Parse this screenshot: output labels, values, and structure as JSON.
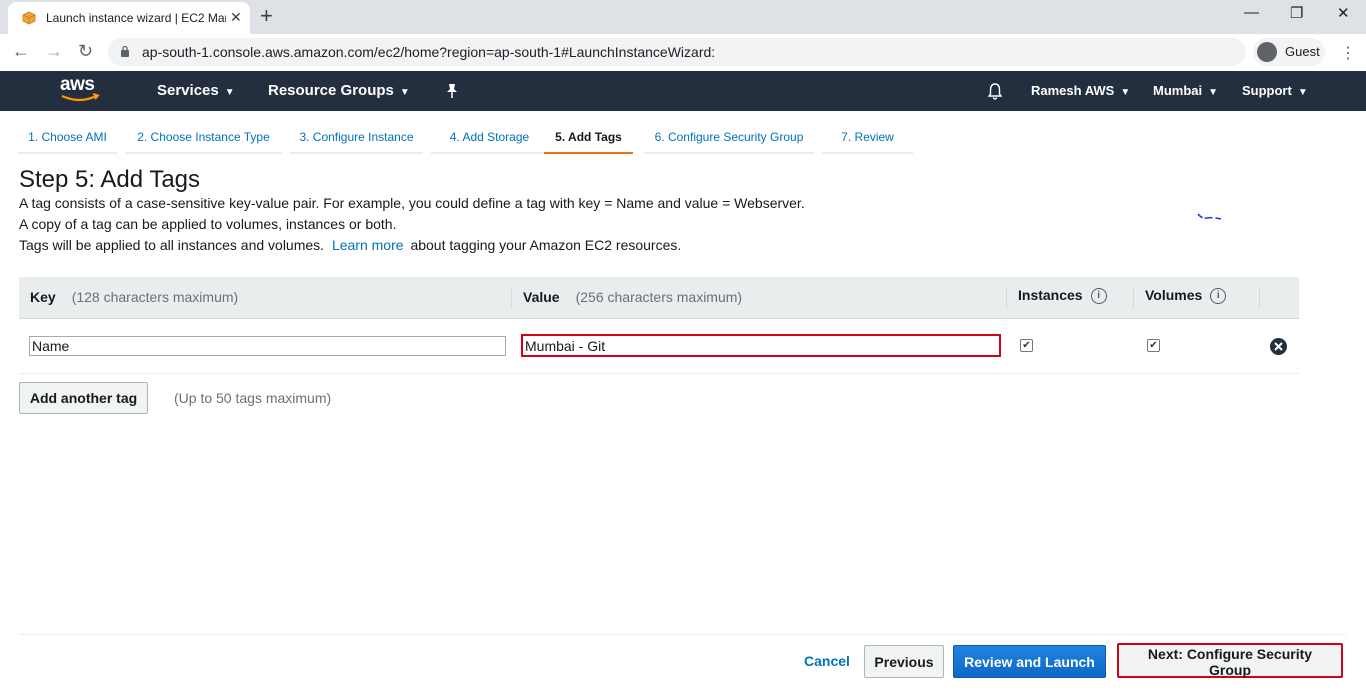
{
  "browser": {
    "tab_title": "Launch instance wizard | EC2 Management Console",
    "url": "ap-south-1.console.aws.amazon.com/ec2/home?region=ap-south-1#LaunchInstanceWizard:",
    "profile_label": "Guest",
    "icons": [
      "favicon-icon",
      "close-icon",
      "plus-icon",
      "minimize-icon",
      "restore-icon",
      "back-icon",
      "forward-icon",
      "reload-icon",
      "lock-icon",
      "avatar-icon",
      "kebab-icon"
    ]
  },
  "aws_nav": {
    "logo_text": "aws",
    "services": "Services",
    "resource_groups": "Resource Groups",
    "user": "Ramesh AWS",
    "region": "Mumbai",
    "support": "Support"
  },
  "steps": [
    {
      "label": "1. Choose AMI"
    },
    {
      "label": "2. Choose Instance Type"
    },
    {
      "label": "3. Configure Instance"
    },
    {
      "label": "4. Add Storage"
    },
    {
      "label": "5. Add Tags"
    },
    {
      "label": "6. Configure Security Group"
    },
    {
      "label": "7. Review"
    }
  ],
  "active_step": 4,
  "page": {
    "title": "Step 5: Add Tags",
    "desc1": "A tag consists of a case-sensitive key-value pair. For example, you could define a tag with key = Name and value = Webserver.",
    "desc2": "A copy of a tag can be applied to volumes, instances or both.",
    "desc3_pre": "Tags will be applied to all instances and volumes.",
    "desc3_link": "Learn more",
    "desc3_post": "about tagging your Amazon EC2 resources."
  },
  "table": {
    "headers": {
      "key": "Key",
      "key_hint": "(128 characters maximum)",
      "value": "Value",
      "value_hint": "(256 characters maximum)",
      "instances": "Instances",
      "volumes": "Volumes"
    },
    "rows": [
      {
        "key": "Name",
        "value": "Mumbai - Git",
        "instances": true,
        "volumes": true
      }
    ]
  },
  "add_tag": {
    "button": "Add another tag",
    "limit": "(Up to 50 tags maximum)"
  },
  "footer": {
    "cancel": "Cancel",
    "previous": "Previous",
    "review": "Review and Launch",
    "next": "Next: Configure Security Group"
  },
  "colors": {
    "aws_nav_bg": "#232f3e",
    "link": "#0073bb",
    "active_step": "#ec7211",
    "highlight": "#d0021b",
    "primary_button": "#0f67c6"
  }
}
